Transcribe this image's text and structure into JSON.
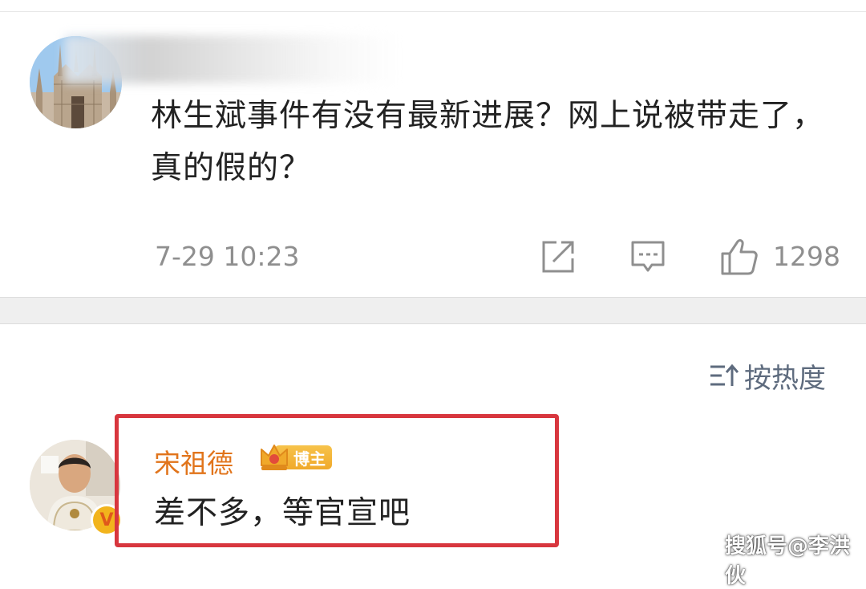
{
  "post": {
    "text": "林生斌事件有没有最新进展？网上说被带走了，真的假的？",
    "time": "7-29 10:23",
    "like_count": "1298",
    "icons": [
      "share-icon",
      "comment-icon",
      "like-icon"
    ]
  },
  "sort": {
    "label": "按热度",
    "icon": "sort-icon"
  },
  "comment": {
    "username": "宋祖德",
    "badge_label": "博主",
    "text": "差不多，等官宣吧"
  },
  "watermark": "搜狐号@李洪伙",
  "colors": {
    "username": "#e1741b",
    "highlight_border": "#d8363e",
    "meta_gray": "#8f8f8f",
    "sort_label": "#5e6b7e"
  }
}
